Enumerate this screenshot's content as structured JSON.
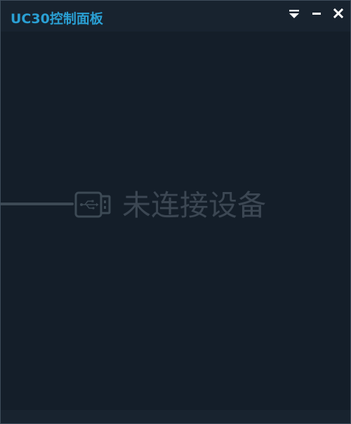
{
  "window": {
    "title": "UC30控制面板"
  },
  "titlebar": {
    "buttons": [
      {
        "name": "menu-dropdown-button",
        "icon": "dropdown-arrow-icon"
      },
      {
        "name": "minimize-button",
        "icon": "minimize-icon"
      },
      {
        "name": "close-button",
        "icon": "close-icon"
      }
    ]
  },
  "main": {
    "status_text": "未连接设备",
    "status_icon": "usb-plug-icon"
  },
  "colors": {
    "title": "#2aa0d4",
    "background": "#141e29",
    "titlebar": "#18232f",
    "status_text": "#3c4753",
    "icon_white": "#ffffff"
  }
}
